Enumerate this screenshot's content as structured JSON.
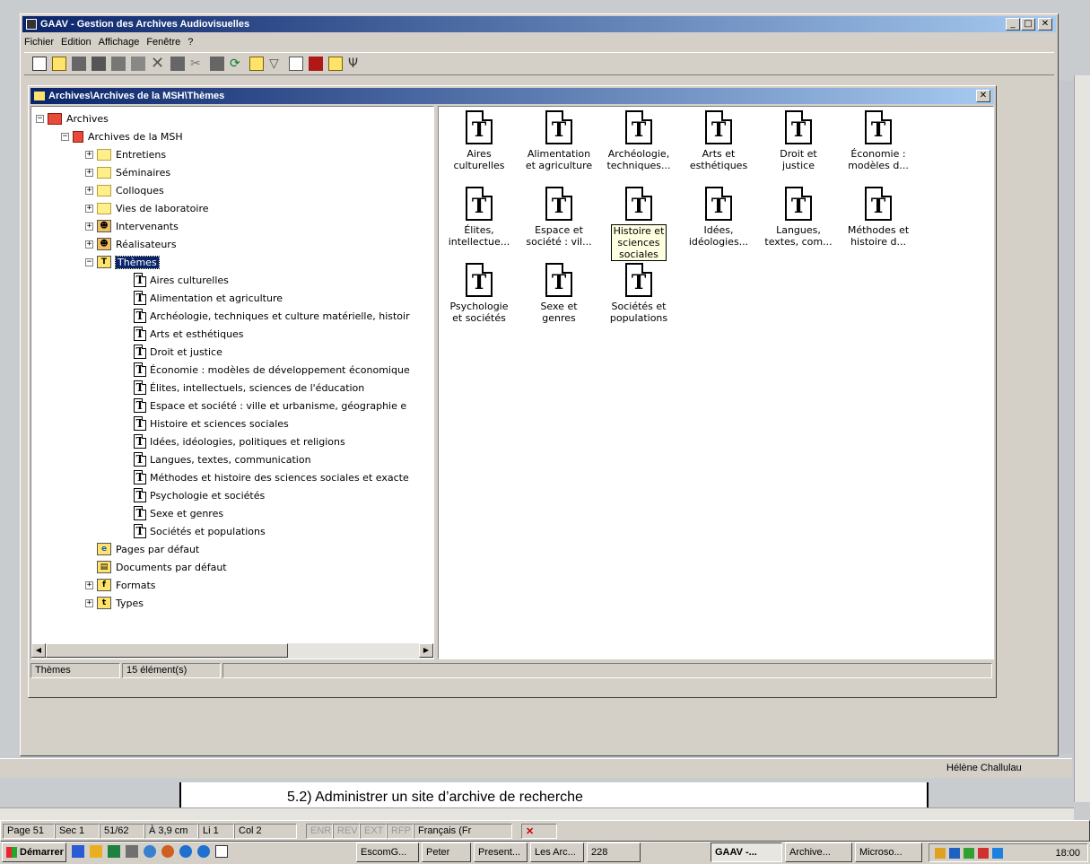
{
  "app": {
    "title": "GAAV - Gestion des Archives Audiovisuelles",
    "menu": [
      "Fichier",
      "Edition",
      "Affichage",
      "Fenêtre",
      "?"
    ]
  },
  "child_window": {
    "title": "Archives\\Archives de la MSH\\Thèmes"
  },
  "tree": {
    "root": "Archives",
    "msh": "Archives de la MSH",
    "folders": [
      "Entretiens",
      "Séminaires",
      "Colloques",
      "Vies de laboratoire",
      "Intervenants",
      "Réalisateurs"
    ],
    "themes_label": "Thèmes",
    "themes": [
      "Aires culturelles",
      "Alimentation et agriculture",
      "Archéologie, techniques et culture matérielle, histoir",
      "Arts et esthétiques",
      "Droit et justice",
      "Économie : modèles de développement économique",
      "Élites, intellectuels, sciences de l'éducation",
      "Espace et société : ville et urbanisme, géographie e",
      "Histoire et sciences sociales",
      "Idées, idéologies, politiques et religions",
      "Langues, textes, communication",
      "Méthodes et histoire des sciences sociales et exacte",
      "Psychologie et sociétés",
      "Sexe et genres",
      "Sociétés et populations"
    ],
    "bottom": [
      "Pages par défaut",
      "Documents par défaut",
      "Formats",
      "Types"
    ]
  },
  "grid": {
    "items": [
      [
        "Aires",
        "culturelles"
      ],
      [
        "Alimentation",
        "et agriculture"
      ],
      [
        "Archéologie,",
        "techniques..."
      ],
      [
        "Arts et",
        "esthétiques"
      ],
      [
        "Droit et",
        "justice"
      ],
      [
        "Économie :",
        "modèles d..."
      ],
      [
        "Élites,",
        "intellectue..."
      ],
      [
        "Espace et",
        "société : vil..."
      ],
      [
        "Histoire et",
        "sciences",
        "sociales"
      ],
      [
        "Idées,",
        "idéologies..."
      ],
      [
        "Langues,",
        "textes, com..."
      ],
      [
        "Méthodes et",
        "histoire d..."
      ],
      [
        "Psychologie",
        "et sociétés"
      ],
      [
        "Sexe et",
        "genres"
      ],
      [
        "Sociétés et",
        "populations"
      ]
    ],
    "selected_index": 8
  },
  "status": {
    "path": "Thèmes",
    "count": "15 élément(s)"
  },
  "word": {
    "author": "Hélène Challulau",
    "doc_text": "5.2) Administrer un site d’archive de recherche",
    "status": {
      "page": "Page 51",
      "sec": "Sec 1",
      "pages": "51/62",
      "pos": "À 3,9 cm",
      "line": "Li 1",
      "col": "Col 2",
      "enr": "ENR",
      "rev": "REV",
      "ext": "EXT",
      "rfp": "RFP",
      "lang": "Français (Fr"
    }
  },
  "taskbar": {
    "start": "Démarrer",
    "tasks": [
      "EscomG...",
      "Peter",
      "Present...",
      "Les Arc...",
      "228",
      "GAAV -...",
      "Archive...",
      "Microso..."
    ],
    "clock": "18:00"
  }
}
